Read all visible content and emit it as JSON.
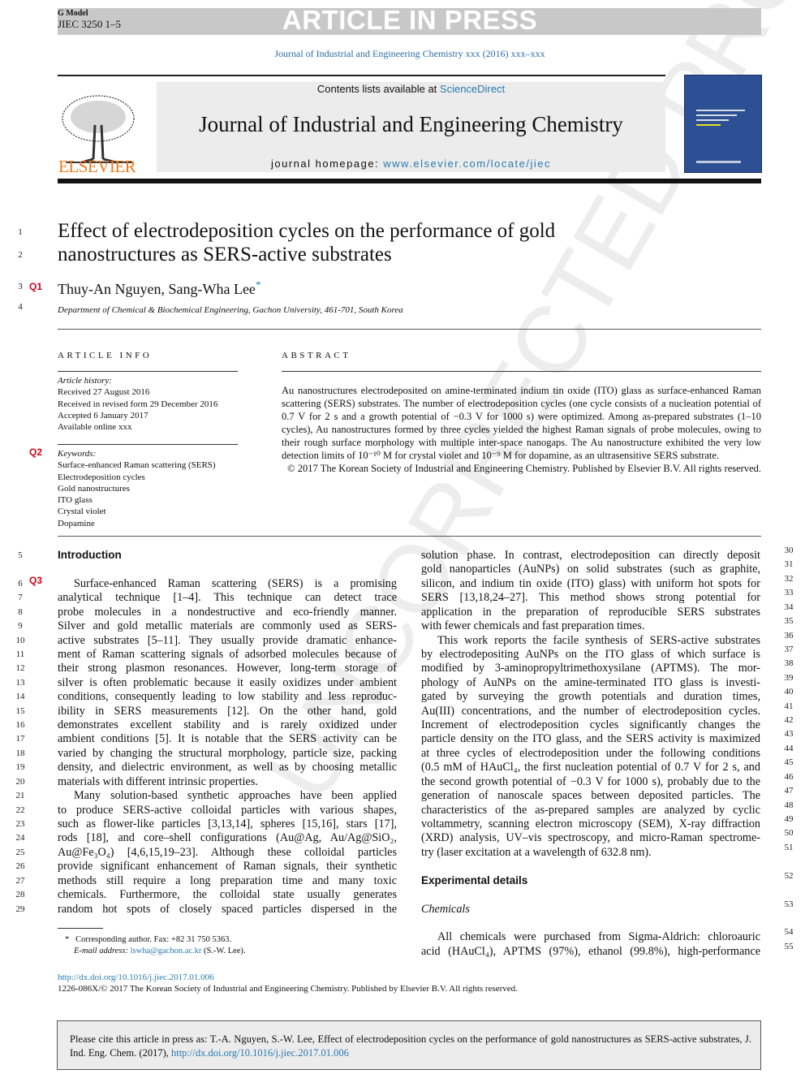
{
  "header": {
    "g_model": "G Model",
    "jiec_id": "JIEC 3250 1–5",
    "article_in_press": "ARTICLE IN PRESS",
    "journal_ref": "Journal of Industrial and Engineering Chemistry xxx (2016) xxx–xxx",
    "contents_prefix": "Contents lists available at ",
    "sciencedirect": "ScienceDirect",
    "journal_title": "Journal of Industrial and Engineering Chemistry",
    "homepage_prefix": "journal homepage: ",
    "homepage_url": "www.elsevier.com/locate/jiec",
    "publisher_logo": "ELSEVIER"
  },
  "watermark": "UNCORRECTED PROOF",
  "article": {
    "title_line1": "Effect of electrodeposition cycles on the performance of gold",
    "title_line2": "nanostructures as SERS-active substrates",
    "authors": "Thuy-An Nguyen, Sang-Wha Lee",
    "author_mark": "*",
    "affiliation": "Department of Chemical & Biochemical Engineering, Gachon University, 461-701, South Korea"
  },
  "queries": {
    "q1": "Q1",
    "q2": "Q2",
    "q3": "Q3"
  },
  "line_numbers_head": [
    "1",
    "2",
    "3",
    "4"
  ],
  "article_info": {
    "heading": "ARTICLE INFO",
    "history_label": "Article history:",
    "history": [
      "Received 27 August 2016",
      "Received in revised form 29 December 2016",
      "Accepted 6 January 2017",
      "Available online xxx"
    ],
    "keywords_label": "Keywords:",
    "keywords": [
      "Surface-enhanced Raman scattering (SERS)",
      "Electrodeposition cycles",
      "Gold nanostructures",
      "ITO glass",
      "Crystal violet",
      "Dopamine"
    ]
  },
  "abstract": {
    "heading": "ABSTRACT",
    "text": "Au nanostructures electrodeposited on amine-terminated indium tin oxide (ITO) glass as surface-enhanced Raman scattering (SERS) substrates. The number of electrodeposition cycles (one cycle consists of a nucleation potential of 0.7 V for 2 s and a growth potential of −0.3 V for 1000 s) were optimized. Among as-prepared substrates (1–10 cycles), Au nanostructures formed by three cycles yielded the highest Raman signals of probe molecules, owing to their rough surface morphology with multiple inter-space nanogaps. The Au nanostructure exhibited the very low detection limits of 10⁻¹⁰ M for crystal violet and 10⁻⁹ M for dopamine, as an ultrasensitive SERS substrate.",
    "copyright": "© 2017 The Korean Society of Industrial and Engineering Chemistry. Published by Elsevier B.V. All rights reserved."
  },
  "left_column": [
    {
      "n": "5",
      "t": "Introduction",
      "c": "head"
    },
    {
      "n": "",
      "t": "",
      "c": "last"
    },
    {
      "n": "6",
      "t": "Surface-enhanced Raman scattering (SERS) is a promising",
      "c": "indent"
    },
    {
      "n": "7",
      "t": "analytical technique [1–4]. This technique can detect trace",
      "c": ""
    },
    {
      "n": "8",
      "t": "probe molecules in a nondestructive and eco-friendly manner.",
      "c": ""
    },
    {
      "n": "9",
      "t": "Silver and gold metallic materials are commonly used as SERS-",
      "c": ""
    },
    {
      "n": "10",
      "t": "active substrates [5–11]. They usually provide dramatic enhance-",
      "c": ""
    },
    {
      "n": "11",
      "t": "ment of Raman scattering signals of adsorbed molecules because of",
      "c": ""
    },
    {
      "n": "12",
      "t": "their strong plasmon resonances. However, long-term storage of",
      "c": ""
    },
    {
      "n": "13",
      "t": "silver is often problematic because it easily oxidizes under ambient",
      "c": ""
    },
    {
      "n": "14",
      "t": "conditions, consequently leading to low stability and less reproduc-",
      "c": ""
    },
    {
      "n": "15",
      "t": "ibility in SERS measurements [12]. On the other hand, gold",
      "c": ""
    },
    {
      "n": "16",
      "t": "demonstrates excellent stability and is rarely oxidized under",
      "c": ""
    },
    {
      "n": "17",
      "t": "ambient conditions [5]. It is notable that the SERS activity can be",
      "c": ""
    },
    {
      "n": "18",
      "t": "varied by changing the structural morphology, particle size, packing",
      "c": ""
    },
    {
      "n": "19",
      "t": "density, and dielectric environment, as well as by choosing metallic",
      "c": ""
    },
    {
      "n": "20",
      "t": "materials with different intrinsic properties.",
      "c": "last"
    },
    {
      "n": "21",
      "t": "Many solution-based synthetic approaches have been applied",
      "c": "indent"
    },
    {
      "n": "22",
      "t": "to produce SERS-active colloidal particles with various shapes,",
      "c": ""
    },
    {
      "n": "23",
      "t": "such as flower-like particles [3,13,14], spheres [15,16], stars [17],",
      "c": ""
    },
    {
      "n": "24",
      "t": "rods [18], and core–shell configurations (Au@Ag, Au/Ag@SiO₂,",
      "c": ""
    },
    {
      "n": "25",
      "t": "Au@Fe₃O₄) [4,6,15,19–23]. Although these colloidal particles",
      "c": ""
    },
    {
      "n": "26",
      "t": "provide significant enhancement of Raman signals, their synthetic",
      "c": ""
    },
    {
      "n": "27",
      "t": "methods still require a long preparation time and many toxic",
      "c": ""
    },
    {
      "n": "28",
      "t": "chemicals. Furthermore, the colloidal state usually generates",
      "c": ""
    },
    {
      "n": "29",
      "t": "random hot spots of closely spaced particles dispersed in the",
      "c": ""
    }
  ],
  "right_column": [
    {
      "n": "30",
      "t": "solution phase. In contrast, electrodeposition can directly deposit",
      "c": ""
    },
    {
      "n": "31",
      "t": "gold nanoparticles (AuNPs) on solid substrates (such as graphite,",
      "c": ""
    },
    {
      "n": "32",
      "t": "silicon, and indium tin oxide (ITO) glass) with uniform hot spots for",
      "c": ""
    },
    {
      "n": "33",
      "t": "SERS [13,18,24–27]. This method shows strong potential for",
      "c": ""
    },
    {
      "n": "34",
      "t": "application in the preparation of reproducible SERS substrates",
      "c": ""
    },
    {
      "n": "35",
      "t": "with fewer chemicals and fast preparation times.",
      "c": "last"
    },
    {
      "n": "36",
      "t": "This work reports the facile synthesis of SERS-active substrates",
      "c": "indent"
    },
    {
      "n": "37",
      "t": "by electrodepositing AuNPs on the ITO glass of which surface is",
      "c": ""
    },
    {
      "n": "38",
      "t": "modified by 3-aminopropyltrimethoxysilane (APTMS). The mor-",
      "c": ""
    },
    {
      "n": "39",
      "t": "phology of AuNPs on the amine-terminated ITO glass is investi-",
      "c": ""
    },
    {
      "n": "40",
      "t": "gated by surveying the growth potentials and duration times,",
      "c": ""
    },
    {
      "n": "41",
      "t": "Au(III) concentrations, and the number of electrodeposition cycles.",
      "c": ""
    },
    {
      "n": "42",
      "t": "Increment of electrodeposition cycles significantly changes the",
      "c": ""
    },
    {
      "n": "43",
      "t": "particle density on the ITO glass, and the SERS activity is maximized",
      "c": ""
    },
    {
      "n": "44",
      "t": "at three cycles of electrodeposition under the following conditions",
      "c": ""
    },
    {
      "n": "45",
      "t": "(0.5 mM of HAuCl₄, the first nucleation potential of 0.7 V for 2 s, and",
      "c": ""
    },
    {
      "n": "46",
      "t": "the second growth potential of −0.3 V for 1000 s), probably due to the",
      "c": ""
    },
    {
      "n": "47",
      "t": "generation of nanoscale spaces between deposited particles. The",
      "c": ""
    },
    {
      "n": "48",
      "t": "characteristics of the as-prepared samples are analyzed by cyclic",
      "c": ""
    },
    {
      "n": "49",
      "t": "voltammetry, scanning electron microscopy (SEM), X-ray diffraction",
      "c": ""
    },
    {
      "n": "50",
      "t": "(XRD) analysis, UV–vis spectroscopy, and micro-Raman spectrome-",
      "c": ""
    },
    {
      "n": "51",
      "t": "try (laser excitation at a wavelength of 632.8 nm).",
      "c": "last"
    },
    {
      "n": "",
      "t": "",
      "c": "last"
    },
    {
      "n": "52",
      "t": "Experimental details",
      "c": "head"
    },
    {
      "n": "",
      "t": "",
      "c": "last"
    },
    {
      "n": "53",
      "t": "Chemicals",
      "c": "ital"
    },
    {
      "n": "",
      "t": "",
      "c": "last"
    },
    {
      "n": "54",
      "t": "All chemicals were purchased from Sigma-Aldrich: chloroauric",
      "c": "indent"
    },
    {
      "n": "55",
      "t": "acid (HAuCl₄), APTMS (97%), ethanol (99.8%), high-performance",
      "c": ""
    }
  ],
  "footnote": {
    "mark": "*",
    "corresponding": "Corresponding author. Fax: +82 31 750 5363.",
    "email_label": "E-mail address: ",
    "email": "lswha@gachon.ac.kr",
    "email_suffix": " (S.-W. Lee)."
  },
  "doi": "http://dx.doi.org/10.1016/j.jiec.2017.01.006",
  "issn_line": "1226-086X/© 2017 The Korean Society of Industrial and Engineering Chemistry. Published by Elsevier B.V. All rights reserved.",
  "cite_box": {
    "text": "Please cite this article in press as: T.-A. Nguyen, S.-W. Lee, Effect of electrodeposition cycles on the performance of gold nanostructures as SERS-active substrates, J. Ind. Eng. Chem. (2017), ",
    "link": "http://dx.doi.org/10.1016/j.jiec.2017.01.006"
  },
  "colors": {
    "link": "#2a7ab0",
    "query": "#d0021b",
    "elsevier": "#f07b1c",
    "cover": "#2d4f93"
  }
}
